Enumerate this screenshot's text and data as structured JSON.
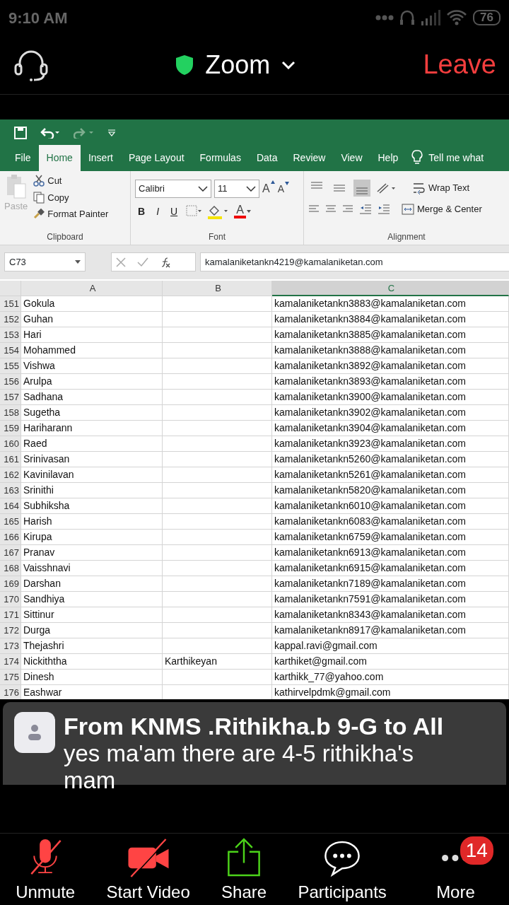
{
  "status_bar": {
    "time": "9:10 AM",
    "battery": "76"
  },
  "header": {
    "title": "Zoom",
    "leave": "Leave"
  },
  "excel": {
    "tabs": [
      {
        "label": "File",
        "selected": false
      },
      {
        "label": "Home",
        "selected": true
      },
      {
        "label": "Insert",
        "selected": false
      },
      {
        "label": "Page Layout",
        "selected": false
      },
      {
        "label": "Formulas",
        "selected": false
      },
      {
        "label": "Data",
        "selected": false
      },
      {
        "label": "Review",
        "selected": false
      },
      {
        "label": "View",
        "selected": false
      },
      {
        "label": "Help",
        "selected": false
      }
    ],
    "tell_me": "Tell me what",
    "clipboard": {
      "paste": "Paste",
      "cut": "Cut",
      "copy": "Copy",
      "format_painter": "Format Painter",
      "label": "Clipboard"
    },
    "font": {
      "name": "Calibri",
      "size": "11",
      "grow": "A",
      "shrink": "A",
      "color_label": "A",
      "bold": "B",
      "italic": "I",
      "underline": "U",
      "label": "Font"
    },
    "alignment": {
      "vertical": [
        {
          "selected": false
        },
        {
          "selected": false
        },
        {
          "selected": true
        }
      ],
      "wrap": "Wrap Text",
      "merge": "Merge & Center",
      "label": "Alignment"
    },
    "formula_bar": {
      "name_box": "C73",
      "value": "kamalaniketankn4219@kamalaniketan.com"
    },
    "columns": [
      {
        "label": "A",
        "selected": false
      },
      {
        "label": "B",
        "selected": false
      },
      {
        "label": "C",
        "selected": true
      }
    ],
    "rows": [
      {
        "num": "151",
        "a": "Gokula",
        "b": "",
        "c": "kamalaniketankn3883@kamalaniketan.com"
      },
      {
        "num": "152",
        "a": "Guhan",
        "b": "",
        "c": "kamalaniketankn3884@kamalaniketan.com"
      },
      {
        "num": "153",
        "a": "Hari",
        "b": "",
        "c": "kamalaniketankn3885@kamalaniketan.com"
      },
      {
        "num": "154",
        "a": "Mohammed",
        "b": "",
        "c": "kamalaniketankn3888@kamalaniketan.com"
      },
      {
        "num": "155",
        "a": "Vishwa",
        "b": "",
        "c": "kamalaniketankn3892@kamalaniketan.com"
      },
      {
        "num": "156",
        "a": "Arulpa",
        "b": "",
        "c": "kamalaniketankn3893@kamalaniketan.com"
      },
      {
        "num": "157",
        "a": "Sadhana",
        "b": "",
        "c": "kamalaniketankn3900@kamalaniketan.com"
      },
      {
        "num": "158",
        "a": "Sugetha",
        "b": "",
        "c": "kamalaniketankn3902@kamalaniketan.com"
      },
      {
        "num": "159",
        "a": "Hariharann",
        "b": "",
        "c": "kamalaniketankn3904@kamalaniketan.com"
      },
      {
        "num": "160",
        "a": "Raed",
        "b": "",
        "c": "kamalaniketankn3923@kamalaniketan.com"
      },
      {
        "num": "161",
        "a": "Srinivasan",
        "b": "",
        "c": "kamalaniketankn5260@kamalaniketan.com"
      },
      {
        "num": "162",
        "a": "Kavinilavan",
        "b": "",
        "c": "kamalaniketankn5261@kamalaniketan.com"
      },
      {
        "num": "163",
        "a": "Srinithi",
        "b": "",
        "c": "kamalaniketankn5820@kamalaniketan.com"
      },
      {
        "num": "164",
        "a": "Subhiksha",
        "b": "",
        "c": "kamalaniketankn6010@kamalaniketan.com"
      },
      {
        "num": "165",
        "a": "Harish",
        "b": "",
        "c": "kamalaniketankn6083@kamalaniketan.com"
      },
      {
        "num": "166",
        "a": "Kirupa",
        "b": "",
        "c": "kamalaniketankn6759@kamalaniketan.com"
      },
      {
        "num": "167",
        "a": "Pranav",
        "b": "",
        "c": "kamalaniketankn6913@kamalaniketan.com"
      },
      {
        "num": "168",
        "a": "Vaisshnavi",
        "b": "",
        "c": "kamalaniketankn6915@kamalaniketan.com"
      },
      {
        "num": "169",
        "a": "Darshan",
        "b": "",
        "c": "kamalaniketankn7189@kamalaniketan.com"
      },
      {
        "num": "170",
        "a": "Sandhiya",
        "b": "",
        "c": "kamalaniketankn7591@kamalaniketan.com"
      },
      {
        "num": "171",
        "a": "Sittinur",
        "b": "",
        "c": "kamalaniketankn8343@kamalaniketan.com"
      },
      {
        "num": "172",
        "a": "Durga",
        "b": "",
        "c": "kamalaniketankn8917@kamalaniketan.com"
      },
      {
        "num": "173",
        "a": "Thejashri",
        "b": "",
        "c": "kappal.ravi@gmail.com"
      },
      {
        "num": "174",
        "a": "Nickiththa",
        "b": "Karthikeyan",
        "c": "karthiket@gmail.com"
      },
      {
        "num": "175",
        "a": "Dinesh",
        "b": "",
        "c": "karthikk_77@yahoo.com"
      },
      {
        "num": "176",
        "a": "Eashwar",
        "b": "",
        "c": "kathirvelpdmk@gmail.com"
      }
    ]
  },
  "chat": {
    "sender": "From KNMS .Rithikha.b 9-G to All",
    "message": "yes ma'am there are 4-5 rithikha's mam"
  },
  "toolbar": [
    {
      "kind": "mic",
      "label": "Unmute"
    },
    {
      "kind": "video",
      "label": "Start Video"
    },
    {
      "kind": "share",
      "label": "Share"
    },
    {
      "kind": "participants",
      "label": "Participants"
    },
    {
      "kind": "more",
      "label": "More",
      "badge": "14"
    }
  ]
}
